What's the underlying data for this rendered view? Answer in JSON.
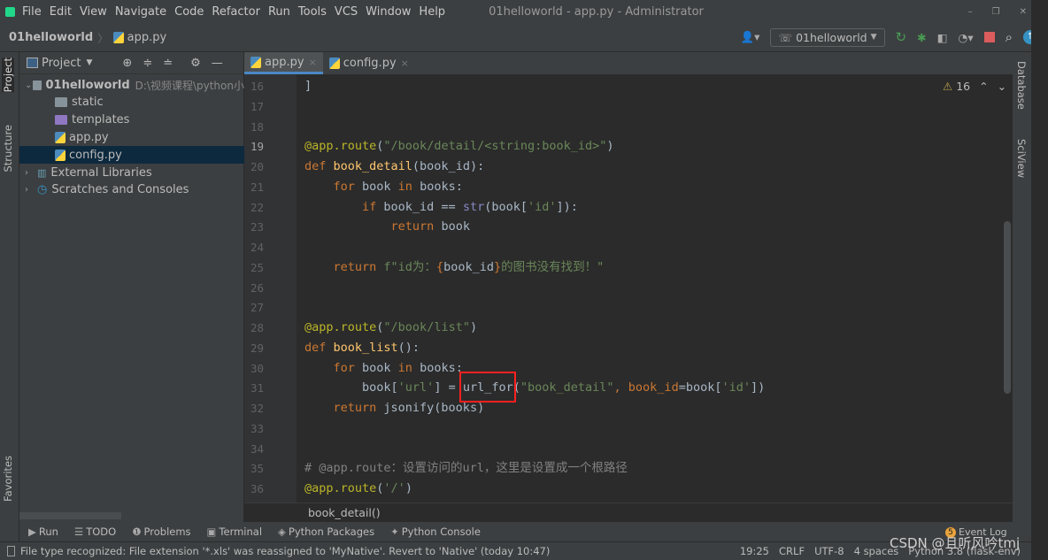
{
  "window": {
    "title": "01helloworld - app.py - Administrator",
    "menu": [
      "File",
      "Edit",
      "View",
      "Navigate",
      "Code",
      "Refactor",
      "Run",
      "Tools",
      "VCS",
      "Window",
      "Help"
    ],
    "controls": [
      "–",
      "❐",
      "✕"
    ]
  },
  "navbar": {
    "project": "01helloworld",
    "file": "app.py",
    "run_config": "01helloworld"
  },
  "left_strip": {
    "project": "Project",
    "structure": "Structure",
    "favorites": "Favorites"
  },
  "right_strip": {
    "database": "Database",
    "sciview": "SciView"
  },
  "project_panel": {
    "title": "Project",
    "tree": [
      {
        "label": "01helloworld",
        "path": "D:\\视频课程\\python小",
        "type": "folder",
        "level": 0,
        "expanded": true
      },
      {
        "label": "static",
        "type": "folder",
        "level": 1
      },
      {
        "label": "templates",
        "type": "folder-purple",
        "level": 1
      },
      {
        "label": "app.py",
        "type": "python",
        "level": 1
      },
      {
        "label": "config.py",
        "type": "python",
        "level": 1,
        "selected": true
      },
      {
        "label": "External Libraries",
        "type": "library",
        "level": 0
      },
      {
        "label": "Scratches and Consoles",
        "type": "scratch",
        "level": 0
      }
    ]
  },
  "editor": {
    "tabs": [
      {
        "label": "app.py",
        "active": true
      },
      {
        "label": "config.py",
        "active": false
      }
    ],
    "warnings": "16",
    "current_line": 19,
    "lines": [
      {
        "n": "16",
        "t": [
          [
            "]",
            "p"
          ]
        ]
      },
      {
        "n": "17",
        "t": []
      },
      {
        "n": "18",
        "t": []
      },
      {
        "n": "19",
        "t": [
          [
            "@app.route",
            "d"
          ],
          [
            "(",
            "p"
          ],
          [
            "\"/book/detail/<string:book_id>\"",
            "s"
          ],
          [
            ")",
            "p"
          ]
        ]
      },
      {
        "n": "20",
        "t": [
          [
            "def ",
            "k"
          ],
          [
            "book_detail",
            "f"
          ],
          [
            "(book_id):",
            "p"
          ]
        ]
      },
      {
        "n": "21",
        "t": [
          [
            "    for ",
            "k"
          ],
          [
            "book ",
            "p"
          ],
          [
            "in ",
            "k"
          ],
          [
            "books:",
            "p"
          ]
        ]
      },
      {
        "n": "22",
        "t": [
          [
            "        if ",
            "k"
          ],
          [
            "book_id == ",
            "p"
          ],
          [
            "str",
            "b"
          ],
          [
            "(book[",
            "p"
          ],
          [
            "'id'",
            "s"
          ],
          [
            "]):",
            "p"
          ]
        ]
      },
      {
        "n": "23",
        "t": [
          [
            "            return ",
            "k"
          ],
          [
            "book",
            "p"
          ]
        ]
      },
      {
        "n": "24",
        "t": []
      },
      {
        "n": "25",
        "t": [
          [
            "    return ",
            "k"
          ],
          [
            "f\"id为：",
            "s"
          ],
          [
            "{",
            "k"
          ],
          [
            "book_id",
            "p"
          ],
          [
            "}",
            "k"
          ],
          [
            "的图书没有找到！\"",
            "s"
          ]
        ]
      },
      {
        "n": "26",
        "t": []
      },
      {
        "n": "27",
        "t": []
      },
      {
        "n": "28",
        "t": [
          [
            "@app.route",
            "d"
          ],
          [
            "(",
            "p"
          ],
          [
            "\"/book/list\"",
            "s"
          ],
          [
            ")",
            "p"
          ]
        ]
      },
      {
        "n": "29",
        "t": [
          [
            "def ",
            "k"
          ],
          [
            "book_list",
            "f"
          ],
          [
            "():",
            "p"
          ]
        ]
      },
      {
        "n": "30",
        "t": [
          [
            "    for ",
            "k"
          ],
          [
            "book ",
            "p"
          ],
          [
            "in ",
            "k"
          ],
          [
            "books:",
            "p"
          ]
        ]
      },
      {
        "n": "31",
        "t": [
          [
            "        book[",
            "p"
          ],
          [
            "'url'",
            "s"
          ],
          [
            "] = url_for(",
            "p"
          ],
          [
            "\"book_detail\"",
            "s"
          ],
          [
            ", ",
            "k"
          ],
          [
            "book_id",
            "k"
          ],
          [
            "=book[",
            "p"
          ],
          [
            "'id'",
            "s"
          ],
          [
            "])",
            "p"
          ]
        ]
      },
      {
        "n": "32",
        "t": [
          [
            "    return ",
            "k"
          ],
          [
            "jsonify(books)",
            "p"
          ]
        ]
      },
      {
        "n": "33",
        "t": []
      },
      {
        "n": "34",
        "t": []
      },
      {
        "n": "35",
        "t": [
          [
            "# @app.route：设置访问的url，这里是设置成一个根路径",
            "c"
          ]
        ]
      },
      {
        "n": "36",
        "t": [
          [
            "@app.route",
            "d"
          ],
          [
            "(",
            "p"
          ],
          [
            "'/'",
            "s"
          ],
          [
            ")",
            "p"
          ]
        ]
      }
    ],
    "breadcrumb": "book_detail()"
  },
  "tool_windows": [
    "Run",
    "TODO",
    "Problems",
    "Terminal",
    "Python Packages",
    "Python Console"
  ],
  "event_log": {
    "label": "Event Log",
    "count": "5"
  },
  "status": {
    "message": "File type recognized: File extension '*.xls' was reassigned to 'MyNative'. Revert to 'Native' (today 10:47)",
    "position": "19:25",
    "line_sep": "CRLF",
    "encoding": "UTF-8",
    "indent": "4 spaces",
    "interpreter": "Python 3.8 (flask-env)"
  },
  "watermark": "CSDN @且听风吟tmj",
  "colors": {
    "accent": "#4a88c7",
    "highlight_box": "#ff2020",
    "stop": "#db5c5c",
    "run": "#499c54"
  }
}
